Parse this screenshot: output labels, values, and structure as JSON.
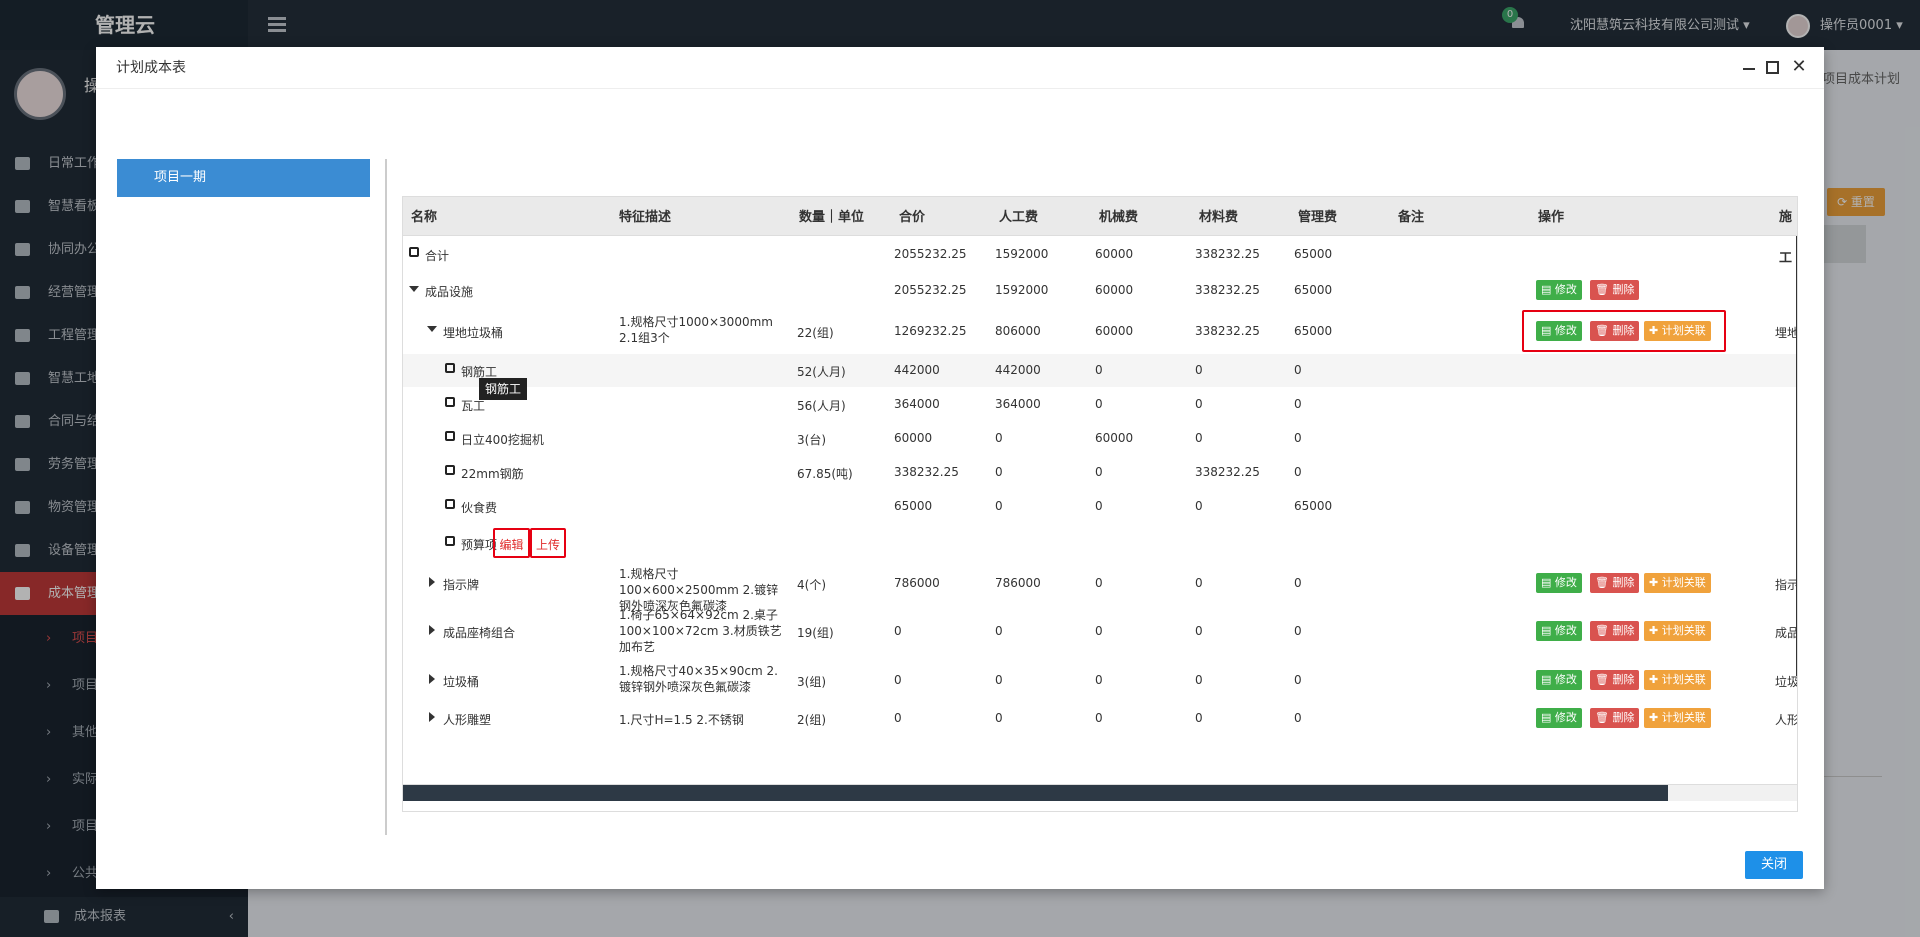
{
  "app": {
    "brand": "管理云",
    "notification_count": "0",
    "company": "沈阳慧筑云科技有限公司测试 ▾",
    "user": "操作员0001 ▾"
  },
  "sidebar": {
    "user_initial": "操",
    "items": [
      {
        "label": "日常工作"
      },
      {
        "label": "智慧看板"
      },
      {
        "label": "协同办公"
      },
      {
        "label": "经营管理"
      },
      {
        "label": "工程管理"
      },
      {
        "label": "智慧工地"
      },
      {
        "label": "合同与结"
      },
      {
        "label": "劳务管理"
      },
      {
        "label": "物资管理"
      },
      {
        "label": "设备管理"
      },
      {
        "label": "成本管理"
      }
    ],
    "subitems": [
      {
        "label": "项目"
      },
      {
        "label": "项目"
      },
      {
        "label": "其他"
      },
      {
        "label": "实际"
      },
      {
        "label": "项目"
      },
      {
        "label": "公共"
      }
    ],
    "bottom_item": "成本报表"
  },
  "background": {
    "breadcrumb": "项目成本计划",
    "reset_label": "⟳ 重置"
  },
  "modal": {
    "title": "计划成本表",
    "tree_item": "项目一期",
    "close_label": "关闭",
    "columns": [
      "名称",
      "特征描述",
      "数量｜单位",
      "合价",
      "人工费",
      "机械费",
      "材料费",
      "管理费",
      "备注",
      "操作",
      "施工"
    ],
    "rows": [
      {
        "name": "合计",
        "desc": "",
        "qty": "",
        "total": "2055232.25",
        "labor": "1592000",
        "mach": "60000",
        "mat": "338232.25",
        "mgmt": "65000",
        "extra": ""
      },
      {
        "name": "成品设施",
        "desc": "",
        "qty": "",
        "total": "2055232.25",
        "labor": "1592000",
        "mach": "60000",
        "mat": "338232.25",
        "mgmt": "65000",
        "extra": ""
      },
      {
        "name": "埋地垃圾桶",
        "desc": "1.规格尺寸1000×3000mm 2.1组3个",
        "qty": "22(组)",
        "total": "1269232.25",
        "labor": "806000",
        "mach": "60000",
        "mat": "338232.25",
        "mgmt": "65000",
        "extra": "埋地"
      },
      {
        "name": "钢筋工",
        "desc": "",
        "qty": "52(人月)",
        "total": "442000",
        "labor": "442000",
        "mach": "0",
        "mat": "0",
        "mgmt": "0",
        "extra": ""
      },
      {
        "name": "瓦工",
        "desc": "",
        "qty": "56(人月)",
        "total": "364000",
        "labor": "364000",
        "mach": "0",
        "mat": "0",
        "mgmt": "0",
        "extra": ""
      },
      {
        "name": "日立400挖掘机",
        "desc": "",
        "qty": "3(台)",
        "total": "60000",
        "labor": "0",
        "mach": "60000",
        "mat": "0",
        "mgmt": "0",
        "extra": ""
      },
      {
        "name": "22mm钢筋",
        "desc": "",
        "qty": "67.85(吨)",
        "total": "338232.25",
        "labor": "0",
        "mach": "0",
        "mat": "338232.25",
        "mgmt": "0",
        "extra": ""
      },
      {
        "name": "伙食费",
        "desc": "",
        "qty": "",
        "total": "65000",
        "labor": "0",
        "mach": "0",
        "mat": "0",
        "mgmt": "65000",
        "extra": ""
      },
      {
        "name": "预算项",
        "desc": "",
        "qty": "",
        "total": "",
        "labor": "",
        "mach": "",
        "mat": "",
        "mgmt": "",
        "extra": ""
      },
      {
        "name": "指示牌",
        "desc": "1.规格尺寸100×600×2500mm 2.镀锌钢外喷深灰色氟碳漆",
        "qty": "4(个)",
        "total": "786000",
        "labor": "786000",
        "mach": "0",
        "mat": "0",
        "mgmt": "0",
        "extra": "指示"
      },
      {
        "name": "成品座椅组合",
        "desc": "1.椅子65×64×92cm 2.桌子100×100×72cm 3.材质铁艺加布艺",
        "qty": "19(组)",
        "total": "0",
        "labor": "0",
        "mach": "0",
        "mat": "0",
        "mgmt": "0",
        "extra": "成品"
      },
      {
        "name": "垃圾桶",
        "desc": "1.规格尺寸40×35×90cm 2.镀锌钢外喷深灰色氟碳漆",
        "qty": "3(组)",
        "total": "0",
        "labor": "0",
        "mach": "0",
        "mat": "0",
        "mgmt": "0",
        "extra": "垃圾"
      },
      {
        "name": "人形雕塑",
        "desc": "1.尺寸H=1.5 2.不锈钢",
        "qty": "2(组)",
        "total": "0",
        "labor": "0",
        "mach": "0",
        "mat": "0",
        "mgmt": "0",
        "extra": "人形"
      }
    ],
    "actions": {
      "edit": "▤ 修改",
      "delete": "🗑 删除",
      "link": "✚ 计划关联"
    },
    "inline": {
      "edit": "编辑",
      "upload": "上传"
    },
    "tooltip": "钢筋工"
  }
}
